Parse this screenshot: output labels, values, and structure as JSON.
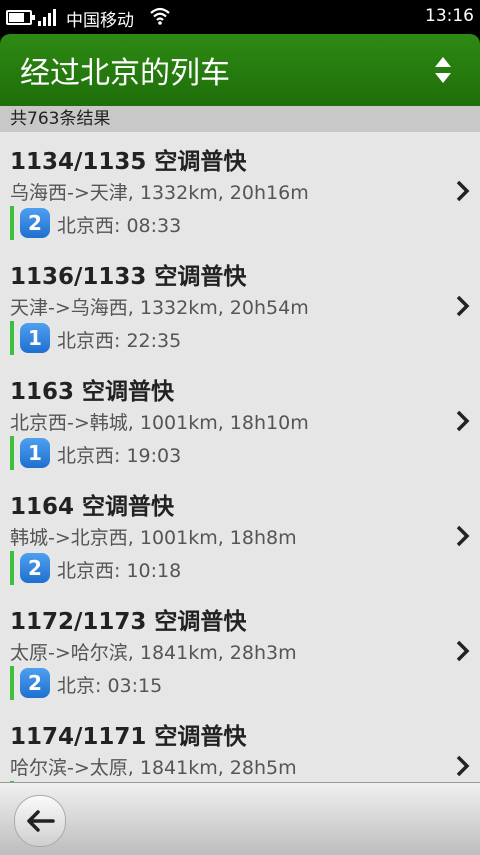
{
  "status_bar": {
    "carrier": "中国移动",
    "time": "13:16",
    "icons": [
      "battery-icon",
      "signal-icon",
      "wifi-icon"
    ]
  },
  "header": {
    "title": "经过北京的列车",
    "sort_icon": "sort-up-down-icon"
  },
  "results": {
    "count_text": "共763条结果"
  },
  "trains": [
    {
      "title": "1134/1135 空调普快",
      "route": "乌海西->天津, 1332km, 20h16m",
      "badge": "2",
      "stop": "北京西: 08:33"
    },
    {
      "title": "1136/1133 空调普快",
      "route": "天津->乌海西, 1332km, 20h54m",
      "badge": "1",
      "stop": "北京西: 22:35"
    },
    {
      "title": "1163 空调普快",
      "route": "北京西->韩城, 1001km, 18h10m",
      "badge": "1",
      "stop": "北京西: 19:03"
    },
    {
      "title": "1164 空调普快",
      "route": "韩城->北京西, 1001km, 18h8m",
      "badge": "2",
      "stop": "北京西: 10:18"
    },
    {
      "title": "1172/1173 空调普快",
      "route": "太原->哈尔滨, 1841km, 28h3m",
      "badge": "2",
      "stop": "北京: 03:15"
    },
    {
      "title": "1174/1171 空调普快",
      "route": "哈尔滨->太原, 1841km, 28h5m",
      "badge": "",
      "stop": ""
    }
  ],
  "toolbar": {
    "back_icon": "back-arrow-icon"
  },
  "colors": {
    "header_green": "#267d0e",
    "badge_blue": "#2f80dd",
    "stop_bar_green": "#3cc13c"
  }
}
